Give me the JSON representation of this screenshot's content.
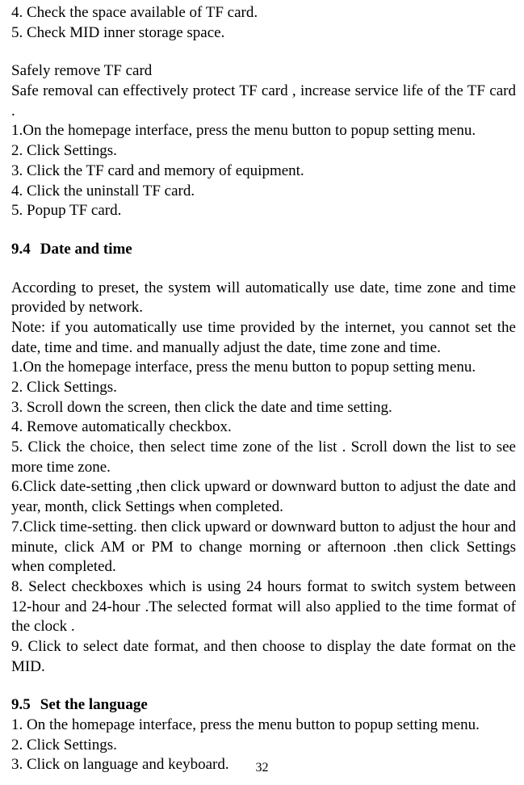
{
  "top_list": {
    "item4": "4. Check the space available of TF card.",
    "item5": "5. Check MID inner storage space."
  },
  "safely_remove": {
    "title": "Safely remove TF card",
    "intro": "Safe removal can effectively protect TF card , increase service life of the TF card .",
    "steps": {
      "s1": "1.On the homepage interface, press the menu button to popup setting menu.",
      "s2": "2. Click Settings.",
      "s3": "3. Click the TF card and memory of equipment.",
      "s4": "4. Click the uninstall TF card.",
      "s5": "5. Popup TF card."
    }
  },
  "section94": {
    "num": "9.4",
    "title": "Date and time",
    "intro": "According to preset, the system will automatically use date, time zone and time provided by network.",
    "note": "Note: if you automatically use time provided by the internet, you cannot set the date, time and time. and manually adjust the date, time zone and time.",
    "steps": {
      "s1": "1.On the homepage interface, press the menu button to popup setting menu.",
      "s2": "2. Click Settings.",
      "s3": "3. Scroll down the screen, then click the date and time setting.",
      "s4": "4. Remove automatically checkbox.",
      "s5": "5. Click the choice, then select time zone of the list . Scroll down the list to see more time zone.",
      "s6": "6.Click date-setting ,then click upward or downward button to adjust the date and year, month, click Settings when completed.",
      "s7": "7.Click time-setting. then click upward or downward button to adjust the hour and minute, click AM or PM to change morning or afternoon .then click Settings when completed.",
      "s8": "8. Select checkboxes which is using 24 hours format to switch system between 12-hour and 24-hour .The selected format will also applied to the time format of the clock .",
      "s9": "9. Click to select date format, and then choose to display the date format on the MID."
    }
  },
  "section95": {
    "num": "9.5",
    "title": "Set the language",
    "steps": {
      "s1": "1. On the homepage interface, press the menu button to popup setting menu.",
      "s2": "2. Click Settings.",
      "s3": "3. Click on language and keyboard."
    }
  },
  "page_number": "32"
}
